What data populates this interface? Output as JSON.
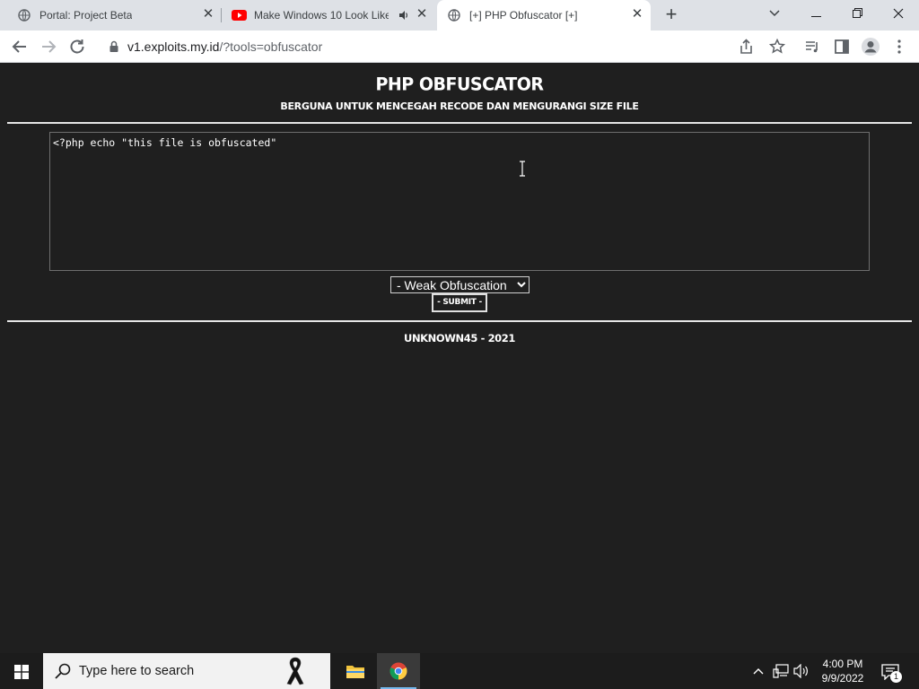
{
  "browser": {
    "tabs": [
      {
        "title": "Portal: Project Beta",
        "close": "✕"
      },
      {
        "title": "Make Windows 10 Look Like",
        "close": "✕"
      },
      {
        "title": "[+] PHP Obfuscator [+]",
        "close": "✕"
      }
    ],
    "new_tab": "+",
    "url_host": "v1.exploits.my.id",
    "url_path": "/?tools=obfuscator"
  },
  "page": {
    "title": "PHP OBFUSCATOR",
    "subtitle": "BERGUNA UNTUK MENCEGAH RECODE DAN MENGURANGI SIZE FILE",
    "code": "<?php echo \"this file is obfuscated\"",
    "mode_selected": "- Weak Obfuscation",
    "submit_label": "- SUBMIT -",
    "footer": "UNKNOWN45 - 2021"
  },
  "taskbar": {
    "search_placeholder": "Type here to search",
    "time": "4:00 PM",
    "date": "9/9/2022",
    "notification_count": "1"
  },
  "colors": {
    "page_bg": "#1f1f1f",
    "text": "#ffffff",
    "tab_strip": "#dee1e6"
  }
}
